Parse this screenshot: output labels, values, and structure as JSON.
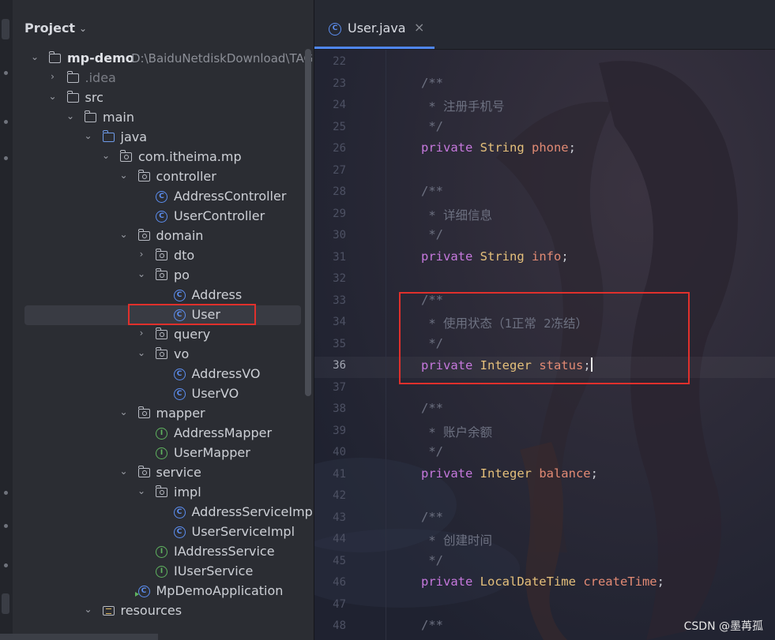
{
  "project_panel": {
    "title": "Project",
    "tree": [
      {
        "label": "mp-demo",
        "path": "D:\\BaiduNetdiskDownload\\TAG",
        "type": "module",
        "arrow": "⌄"
      },
      {
        "label": ".idea",
        "type": "folder",
        "arrow": "›",
        "dim": true
      },
      {
        "label": "src",
        "type": "folder",
        "arrow": "⌄"
      },
      {
        "label": "main",
        "type": "folder",
        "arrow": "⌄"
      },
      {
        "label": "java",
        "type": "source-folder",
        "arrow": "⌄"
      },
      {
        "label": "com.itheima.mp",
        "type": "package",
        "arrow": "⌄"
      },
      {
        "label": "controller",
        "type": "package",
        "arrow": "⌄"
      },
      {
        "label": "AddressController",
        "type": "class"
      },
      {
        "label": "UserController",
        "type": "class"
      },
      {
        "label": "domain",
        "type": "package",
        "arrow": "⌄"
      },
      {
        "label": "dto",
        "type": "package",
        "arrow": "›"
      },
      {
        "label": "po",
        "type": "package",
        "arrow": "⌄"
      },
      {
        "label": "Address",
        "type": "class"
      },
      {
        "label": "User",
        "type": "class",
        "selected": true
      },
      {
        "label": "query",
        "type": "package",
        "arrow": "›"
      },
      {
        "label": "vo",
        "type": "package",
        "arrow": "⌄"
      },
      {
        "label": "AddressVO",
        "type": "class"
      },
      {
        "label": "UserVO",
        "type": "class"
      },
      {
        "label": "mapper",
        "type": "package",
        "arrow": "⌄"
      },
      {
        "label": "AddressMapper",
        "type": "interface"
      },
      {
        "label": "UserMapper",
        "type": "interface"
      },
      {
        "label": "service",
        "type": "package",
        "arrow": "⌄"
      },
      {
        "label": "impl",
        "type": "package",
        "arrow": "⌄"
      },
      {
        "label": "AddressServiceImpl",
        "type": "class"
      },
      {
        "label": "UserServiceImpl",
        "type": "class"
      },
      {
        "label": "IAddressService",
        "type": "interface"
      },
      {
        "label": "IUserService",
        "type": "interface"
      },
      {
        "label": "MpDemoApplication",
        "type": "app-class"
      },
      {
        "label": "resources",
        "type": "resources",
        "arrow": "⌄"
      }
    ]
  },
  "editor": {
    "tab": {
      "label": "User.java",
      "close": "×",
      "icon_letter": "C"
    },
    "lines": [
      {
        "num": "22",
        "parts": []
      },
      {
        "num": "23",
        "parts": [
          {
            "t": "/**",
            "c": "cm"
          }
        ]
      },
      {
        "num": "24",
        "parts": [
          {
            "t": " * 注册手机号",
            "c": "cm"
          }
        ]
      },
      {
        "num": "25",
        "parts": [
          {
            "t": " */",
            "c": "cm"
          }
        ]
      },
      {
        "num": "26",
        "parts": [
          {
            "t": "private ",
            "c": "kw"
          },
          {
            "t": "String ",
            "c": "ty"
          },
          {
            "t": "phone",
            "c": "fd"
          },
          {
            "t": ";",
            "c": "pn"
          }
        ]
      },
      {
        "num": "27",
        "parts": []
      },
      {
        "num": "28",
        "parts": [
          {
            "t": "/**",
            "c": "cm"
          }
        ]
      },
      {
        "num": "29",
        "parts": [
          {
            "t": " * 详细信息",
            "c": "cm"
          }
        ]
      },
      {
        "num": "30",
        "parts": [
          {
            "t": " */",
            "c": "cm"
          }
        ]
      },
      {
        "num": "31",
        "parts": [
          {
            "t": "private ",
            "c": "kw"
          },
          {
            "t": "String ",
            "c": "ty"
          },
          {
            "t": "info",
            "c": "fd"
          },
          {
            "t": ";",
            "c": "pn"
          }
        ]
      },
      {
        "num": "32",
        "parts": []
      },
      {
        "num": "33",
        "parts": [
          {
            "t": "/**",
            "c": "cm"
          }
        ]
      },
      {
        "num": "34",
        "parts": [
          {
            "t": " * 使用状态（1正常 2冻结）",
            "c": "cm"
          }
        ]
      },
      {
        "num": "35",
        "parts": [
          {
            "t": " */",
            "c": "cm"
          }
        ]
      },
      {
        "num": "36",
        "parts": [
          {
            "t": "private ",
            "c": "kw"
          },
          {
            "t": "Integer ",
            "c": "ty"
          },
          {
            "t": "status",
            "c": "fd"
          },
          {
            "t": ";",
            "c": "pn"
          }
        ],
        "current": true
      },
      {
        "num": "37",
        "parts": []
      },
      {
        "num": "38",
        "parts": [
          {
            "t": "/**",
            "c": "cm"
          }
        ]
      },
      {
        "num": "39",
        "parts": [
          {
            "t": " * 账户余额",
            "c": "cm"
          }
        ]
      },
      {
        "num": "40",
        "parts": [
          {
            "t": " */",
            "c": "cm"
          }
        ]
      },
      {
        "num": "41",
        "parts": [
          {
            "t": "private ",
            "c": "kw"
          },
          {
            "t": "Integer ",
            "c": "ty"
          },
          {
            "t": "balance",
            "c": "fd"
          },
          {
            "t": ";",
            "c": "pn"
          }
        ]
      },
      {
        "num": "42",
        "parts": []
      },
      {
        "num": "43",
        "parts": [
          {
            "t": "/**",
            "c": "cm"
          }
        ]
      },
      {
        "num": "44",
        "parts": [
          {
            "t": " * 创建时间",
            "c": "cm"
          }
        ]
      },
      {
        "num": "45",
        "parts": [
          {
            "t": " */",
            "c": "cm"
          }
        ]
      },
      {
        "num": "46",
        "parts": [
          {
            "t": "private ",
            "c": "kw"
          },
          {
            "t": "LocalDateTime ",
            "c": "ty"
          },
          {
            "t": "createTime",
            "c": "fd"
          },
          {
            "t": ";",
            "c": "pn"
          }
        ]
      },
      {
        "num": "47",
        "parts": []
      },
      {
        "num": "48",
        "parts": [
          {
            "t": "/**",
            "c": "cm"
          }
        ]
      }
    ]
  },
  "watermark": "CSDN @墨苒孤",
  "colors": {
    "highlight_box": "#e0302c",
    "accent": "#4f86f0"
  }
}
